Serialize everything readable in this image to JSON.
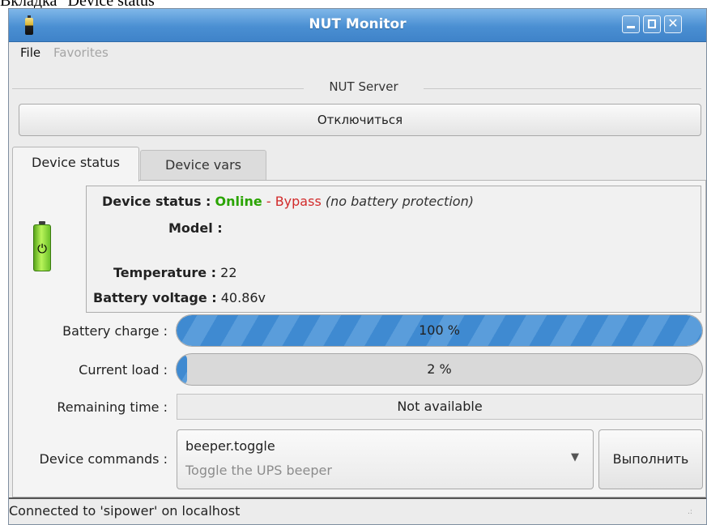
{
  "caption": "Вкладка \"Device status\"",
  "window": {
    "title": "NUT Monitor",
    "controls": {
      "minimize": "minimize",
      "maximize": "maximize",
      "close": "✕"
    }
  },
  "menu": {
    "file": "File",
    "favorites": "Favorites"
  },
  "server_group": {
    "title": "NUT Server",
    "connect_button": "Отключиться"
  },
  "tabs": [
    {
      "label": "Device status",
      "active": true
    },
    {
      "label": "Device vars",
      "active": false
    }
  ],
  "device_status": {
    "status_label": "Device status :",
    "status_online": "Online",
    "status_sep": " - ",
    "status_bypass": "Bypass",
    "status_note": "(no battery protection)",
    "model_label": "Model :",
    "model_value": "",
    "temperature_label": "Temperature :",
    "temperature_value": "22",
    "battery_voltage_label": "Battery voltage :",
    "battery_voltage_value": "40.86v"
  },
  "battery_charge": {
    "label": "Battery charge :",
    "percent": 100,
    "text": "100 %"
  },
  "current_load": {
    "label": "Current load :",
    "percent": 2,
    "text": "2 %"
  },
  "remaining_time": {
    "label": "Remaining time :",
    "value": "Not available"
  },
  "device_commands": {
    "label": "Device commands :",
    "selected_command": "beeper.toggle",
    "selected_description": "Toggle the UPS beeper",
    "execute_button": "Выполнить"
  },
  "statusbar": {
    "text": "Connected to 'sipower' on localhost"
  },
  "colors": {
    "titlebar": "#4a8fd2",
    "online": "#2aa400",
    "bypass": "#d22b2b",
    "progress": "#3f8ad1"
  },
  "icons": {
    "app": "battery-icon",
    "device": "battery-plug-icon",
    "dropdown": "triangle-down-icon"
  }
}
